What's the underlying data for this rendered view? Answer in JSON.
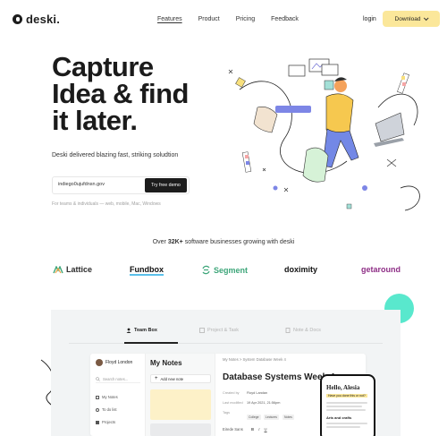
{
  "nav": {
    "logo": "deski.",
    "links": [
      "Features",
      "Product",
      "Pricing",
      "Feedback"
    ],
    "login": "login",
    "download": "Download"
  },
  "hero": {
    "title_lines": [
      "Capture",
      "Idea & find",
      "it later."
    ],
    "subtitle": "Deski delivered blazing fast, striking soludtion",
    "email_value": "indiego0ujufdnsn.gov",
    "cta": "Try free demo",
    "note": "For teams & individuals — web, mobile, Mac, Windows"
  },
  "social_proof": {
    "text_prefix": "Over ",
    "text_bold": "32K+",
    "text_suffix": " software businesses growing with deski",
    "brands": [
      {
        "name": "Lattice",
        "color": "#2b2b2b"
      },
      {
        "name": "Fundbox",
        "color": "#111111"
      },
      {
        "name": "Segment",
        "color": "#3ea67a"
      },
      {
        "name": "doximity",
        "color": "#111111"
      },
      {
        "name": "getaround",
        "color": "#8e2e86"
      }
    ]
  },
  "product": {
    "tabs": [
      "Team Box",
      "Project & Task",
      "Note & Docs"
    ],
    "user_name": "Floyd London",
    "search": "Search notes...",
    "side_items": [
      "My Notes",
      "To do list",
      "Projects"
    ],
    "notes_title": "My Notes",
    "add_note": "Add new note",
    "breadcrumb": "My Notes > System Database Week 4",
    "doc_title": "Database Systems Week 4",
    "meta": [
      {
        "label": "Created by",
        "value": "Floyd Landan"
      },
      {
        "label": "Last modified",
        "value": "19 Apr 2021, 21:56pm"
      },
      {
        "label": "Tags",
        "value": ""
      }
    ],
    "tags": [
      "College",
      "Lectures",
      "Notes"
    ],
    "format_bar": "Eirede Sans",
    "phone": {
      "greeting": "Hello, Alesia",
      "tag": "Have you done this or not?",
      "section": "Arts and crafts"
    }
  }
}
